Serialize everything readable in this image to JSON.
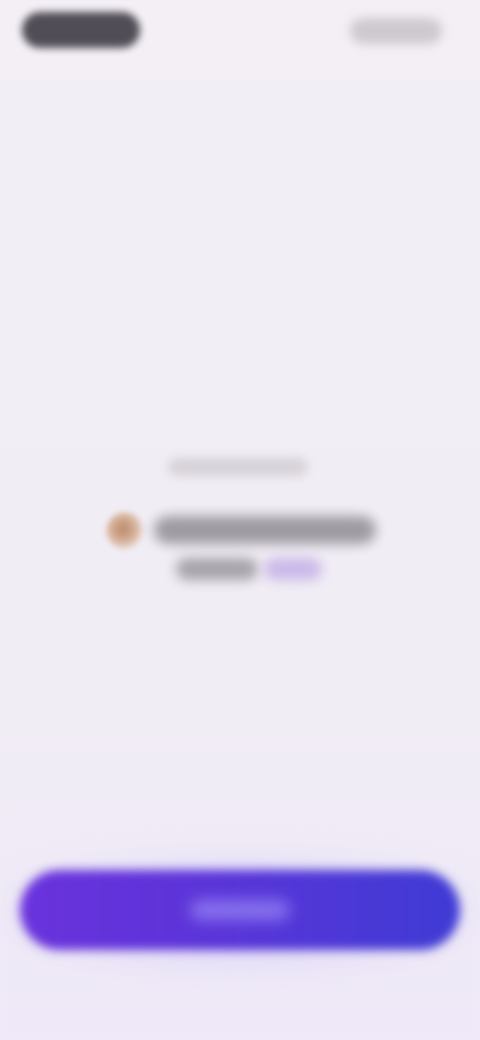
{
  "topbar": {
    "brand_label": "",
    "action_label": ""
  },
  "center": {
    "caption": "",
    "headline": "",
    "subtext": "",
    "subtext_accent": ""
  },
  "cta": {
    "label": ""
  },
  "colors": {
    "background": "#f2eef5",
    "cta_gradient_start": "#6a32dc",
    "cta_gradient_end": "#3f3bd4",
    "status_dot": "#c49a7c",
    "accent_text": "#c9b8e8"
  },
  "icons": {
    "status": "status-dot-icon"
  }
}
